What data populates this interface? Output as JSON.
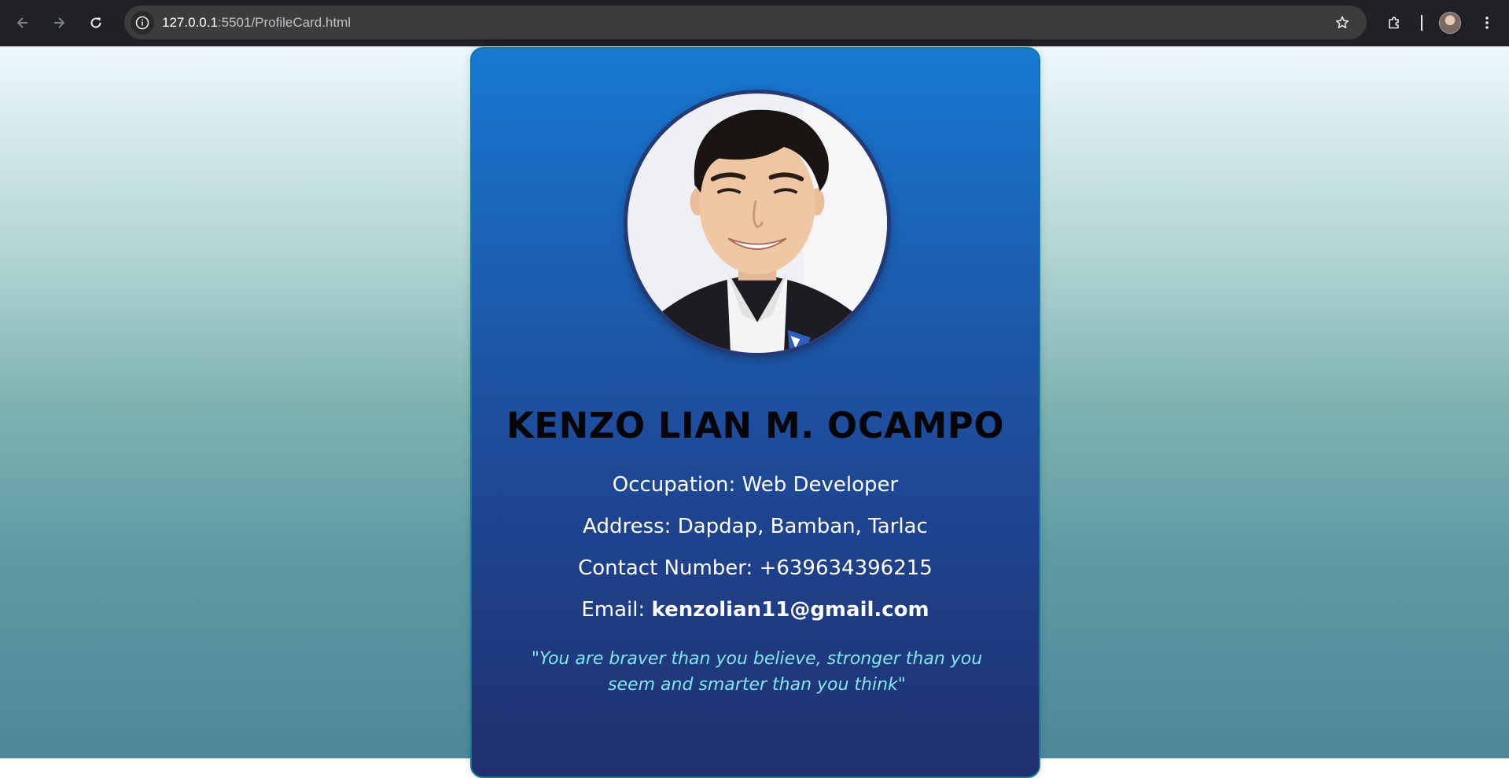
{
  "browser": {
    "url_host": "127.0.0.1",
    "url_rest": ":5501/ProfileCard.html",
    "icons": [
      "back-arrow-icon",
      "forward-arrow-icon",
      "reload-icon",
      "site-info-icon",
      "star-icon",
      "extensions-icon",
      "profile-avatar",
      "kebab-menu-icon"
    ]
  },
  "profile": {
    "name": "KENZO LIAN M. OCAMPO",
    "occupation_label": "Occupation: ",
    "occupation": "Web Developer",
    "address_label": "Address: ",
    "address": "Dapdap, Bamban, Tarlac",
    "contact_label": "Contact Number: ",
    "contact": "+639634396215",
    "email_label": "Email: ",
    "email": "kenzolian11@gmail.com",
    "quote": "\"You are braver than you believe, stronger than you seem and smarter than you think\""
  },
  "colors": {
    "card_top": "#1779d2",
    "card_bottom": "#20306e",
    "quote_text": "#7fe8f0",
    "name_text": "#050508"
  }
}
